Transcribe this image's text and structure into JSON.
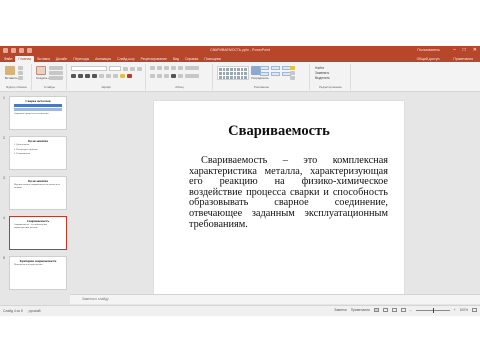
{
  "window": {
    "title": "СВАРИВАЕМОСТЬ.pptx - PowerPoint",
    "user": "Пользователь",
    "controls": [
      "–",
      "□",
      "✕"
    ]
  },
  "tabs": [
    {
      "label": "Файл",
      "active": false
    },
    {
      "label": "Главная",
      "active": true
    },
    {
      "label": "Вставка",
      "active": false
    },
    {
      "label": "Дизайн",
      "active": false
    },
    {
      "label": "Переходы",
      "active": false
    },
    {
      "label": "Анимация",
      "active": false
    },
    {
      "label": "Слайд-шоу",
      "active": false
    },
    {
      "label": "Рецензирование",
      "active": false
    },
    {
      "label": "Вид",
      "active": false
    },
    {
      "label": "Справка",
      "active": false
    },
    {
      "label": "Помощник",
      "active": false
    }
  ],
  "tabs_right": [
    "Общий доступ",
    "Примечания"
  ],
  "ribbon": {
    "groups": [
      "Буфер обмена",
      "Слайды",
      "Шрифт",
      "Абзац",
      "Рисование",
      "Редактирование"
    ],
    "paste_label": "Вставить",
    "new_slide_label": "Создать слайд",
    "arrange_label": "Упорядочить",
    "quick_styles_label": "Экспресс-стили",
    "find_items": [
      "Найти",
      "Заменить",
      "Выделить"
    ]
  },
  "thumbnails": [
    {
      "number": "1",
      "title": "Сварка металлов",
      "lines": [
        "Сварочные процессы и технологии"
      ],
      "selected": false
    },
    {
      "number": "2",
      "title": "Цели занятия",
      "lines": [
        "1. Дать понятие",
        "2. Рассмотреть свойства",
        "3. Ознакомиться"
      ],
      "selected": false
    },
    {
      "number": "3",
      "title": "Цели занятия",
      "lines": [
        "Изучить понятие свариваемости металлов и их сплавов"
      ],
      "selected": false
    },
    {
      "number": "4",
      "title": "Свариваемость",
      "lines": [
        "Свариваемость – это комплексная характеристика металла"
      ],
      "selected": true
    },
    {
      "number": "5",
      "title": "Критерии свариваемости",
      "lines": [
        "Показатели и методы оценки"
      ],
      "selected": false
    }
  ],
  "slide": {
    "title": "Свариваемость",
    "body": "Свариваемость – это комплексная характеристика металла, характеризующая его реакцию на физико-химическое воздействие процесса сварки и способность образовывать сварное соединение, отвечающее заданным эксплуатационным требованиям."
  },
  "notes": {
    "placeholder": "Заметки к слайду"
  },
  "status": {
    "slide_counter": "Слайд 4 из 5",
    "language": "русский",
    "notes_label": "Заметки",
    "comments_label": "Примечания",
    "zoom": "100%",
    "zoom_level": 0.5
  },
  "colors": {
    "accent": "#b7472a",
    "selected_border": "#c0392b"
  }
}
